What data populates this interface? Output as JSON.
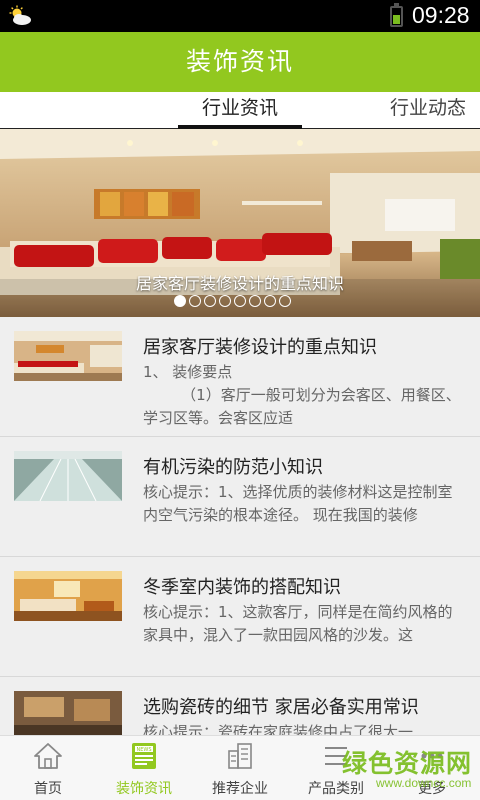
{
  "status_bar": {
    "time": "09:28",
    "weather_icon": "partly-cloudy-icon",
    "battery_level": 0.55
  },
  "header": {
    "title": "装饰资讯"
  },
  "tabs": [
    {
      "label": "行业资讯",
      "active": true
    },
    {
      "label": "行业动态",
      "active": false
    }
  ],
  "banner": {
    "caption": "居家客厅装修设计的重点知识",
    "slide_count": 8,
    "active_slide": 1
  },
  "news": [
    {
      "title": "居家客厅装修设计的重点知识",
      "summary": "1、 装修要点\n        （1）客厅一般可划分为会客区、用餐区、学习区等。会客区应适"
    },
    {
      "title": "有机污染的防范小知识",
      "summary": "核心提示：1、选择优质的装修材料这是控制室内空气污染的根本途径。 现在我国的装修"
    },
    {
      "title": "冬季室内装饰的搭配知识",
      "summary": "核心提示：1、这款客厅，同样是在简约风格的家具中，混入了一款田园风格的沙发。这"
    },
    {
      "title": "选购瓷砖的细节 家居必备实用常识",
      "summary": "核心提示：瓷砖在家庭装修中占了很大一"
    }
  ],
  "bottom_nav": [
    {
      "label": "首页",
      "icon": "home-icon",
      "active": false
    },
    {
      "label": "装饰资讯",
      "icon": "news-icon",
      "active": true
    },
    {
      "label": "推荐企业",
      "icon": "building-icon",
      "active": false
    },
    {
      "label": "产品类别",
      "icon": "list-icon",
      "active": false
    },
    {
      "label": "更多",
      "icon": "more-icon",
      "active": false
    }
  ],
  "watermark": {
    "title": "绿色资源网",
    "url": "www.downcc.com"
  },
  "colors": {
    "accent": "#92c81f",
    "status_bar": "#000000",
    "list_bg": "#efefef"
  }
}
